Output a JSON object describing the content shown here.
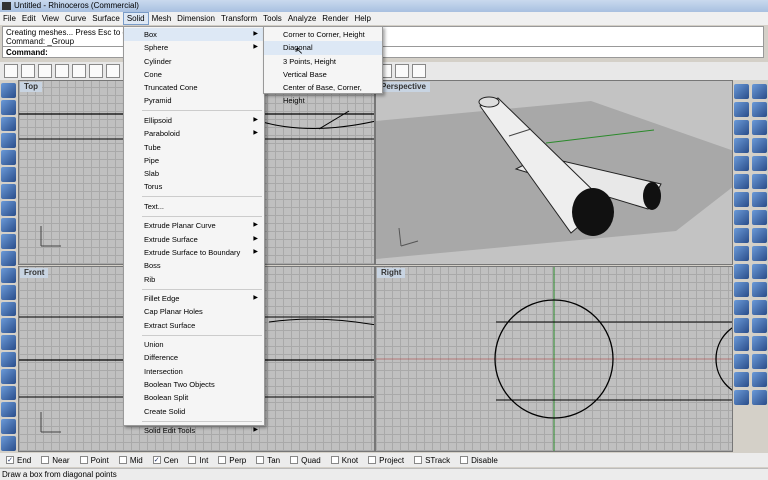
{
  "window": {
    "title": "Untitled - Rhinoceros (Commercial)"
  },
  "menubar": [
    "File",
    "Edit",
    "View",
    "Curve",
    "Surface",
    "Solid",
    "Mesh",
    "Dimension",
    "Transform",
    "Tools",
    "Analyze",
    "Render",
    "Help"
  ],
  "menubar_active": "Solid",
  "command": {
    "history": [
      "Creating meshes... Press Esc to cancel",
      "Command: _Group"
    ],
    "prompt": "Command:"
  },
  "viewports": {
    "top": "Top",
    "perspective": "Perspective",
    "front": "Front",
    "right": "Right"
  },
  "solid_menu": [
    {
      "label": "Box",
      "submenu": true,
      "highlighted": true
    },
    {
      "label": "Sphere",
      "submenu": true
    },
    {
      "label": "Cylinder"
    },
    {
      "label": "Cone"
    },
    {
      "label": "Truncated Cone"
    },
    {
      "label": "Pyramid"
    },
    {
      "sep": true
    },
    {
      "label": "Ellipsoid",
      "submenu": true
    },
    {
      "label": "Paraboloid",
      "submenu": true
    },
    {
      "label": "Tube"
    },
    {
      "label": "Pipe"
    },
    {
      "label": "Slab"
    },
    {
      "label": "Torus"
    },
    {
      "sep": true
    },
    {
      "label": "Text..."
    },
    {
      "sep": true
    },
    {
      "label": "Extrude Planar Curve",
      "submenu": true
    },
    {
      "label": "Extrude Surface",
      "submenu": true
    },
    {
      "label": "Extrude Surface to Boundary",
      "submenu": true
    },
    {
      "label": "Boss"
    },
    {
      "label": "Rib"
    },
    {
      "sep": true
    },
    {
      "label": "Fillet Edge",
      "submenu": true
    },
    {
      "label": "Cap Planar Holes"
    },
    {
      "label": "Extract Surface"
    },
    {
      "sep": true
    },
    {
      "label": "Union"
    },
    {
      "label": "Difference"
    },
    {
      "label": "Intersection"
    },
    {
      "label": "Boolean Two Objects"
    },
    {
      "label": "Boolean Split"
    },
    {
      "label": "Create Solid"
    },
    {
      "sep": true
    },
    {
      "label": "Solid Edit Tools",
      "submenu": true
    }
  ],
  "box_submenu": [
    {
      "label": "Corner to Corner, Height"
    },
    {
      "label": "Diagonal",
      "highlighted": true
    },
    {
      "label": "3 Points, Height"
    },
    {
      "label": "Vertical Base"
    },
    {
      "label": "Center of Base, Corner, Height"
    }
  ],
  "osnaps": [
    {
      "label": "End",
      "checked": true
    },
    {
      "label": "Near",
      "checked": false
    },
    {
      "label": "Point",
      "checked": false
    },
    {
      "label": "Mid",
      "checked": false
    },
    {
      "label": "Cen",
      "checked": true
    },
    {
      "label": "Int",
      "checked": false
    },
    {
      "label": "Perp",
      "checked": false
    },
    {
      "label": "Tan",
      "checked": false
    },
    {
      "label": "Quad",
      "checked": false
    },
    {
      "label": "Knot",
      "checked": false
    },
    {
      "label": "Project",
      "checked": false
    },
    {
      "label": "STrack",
      "checked": false
    },
    {
      "label": "Disable",
      "checked": false
    }
  ],
  "status": "Draw a box from diagonal points"
}
